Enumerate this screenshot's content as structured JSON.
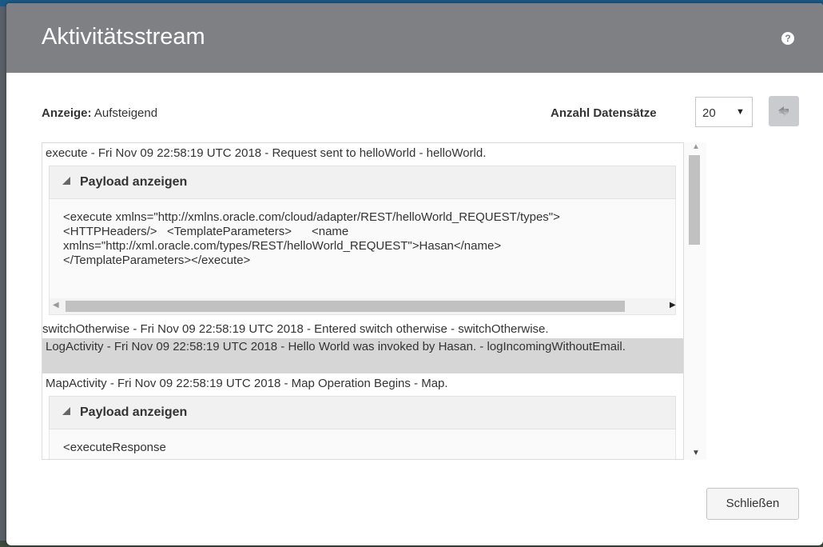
{
  "dialog": {
    "title": "Aktivitätsstream",
    "help_icon": "?",
    "close_label": "Schließen"
  },
  "toolbar": {
    "display_label": "Anzeige:",
    "display_value": "Aufsteigend",
    "records_label": "Anzahl Datensätze",
    "records_value": "20",
    "refresh_icon": "refresh-icon"
  },
  "stream": {
    "entries": [
      "execute - Fri Nov 09 22:58:19 UTC 2018 - Request sent to helloWorld - helloWorld.",
      "switchOtherwise - Fri Nov 09 22:58:19 UTC 2018 - Entered switch otherwise - switchOtherwise.",
      "LogActivity - Fri Nov 09 22:58:19 UTC 2018 - Hello World was invoked by Hasan. - logIncomingWithoutEmail.",
      "MapActivity - Fri Nov 09 22:58:19 UTC 2018 - Map Operation Begins - Map."
    ],
    "payload_toggle": "Payload anzeigen",
    "payload1": "<execute xmlns=\"http://xmlns.oracle.com/cloud/adapter/REST/helloWorld_REQUEST/types\">\n<HTTPHeaders/>   <TemplateParameters>      <name\nxmlns=\"http://xml.oracle.com/types/REST/helloWorld_REQUEST\">Hasan</name>\n</TemplateParameters></execute>",
    "payload2": "<executeResponse"
  },
  "colors": {
    "header_bg": "#7e8084",
    "highlight_row": "#d6d6d6"
  }
}
